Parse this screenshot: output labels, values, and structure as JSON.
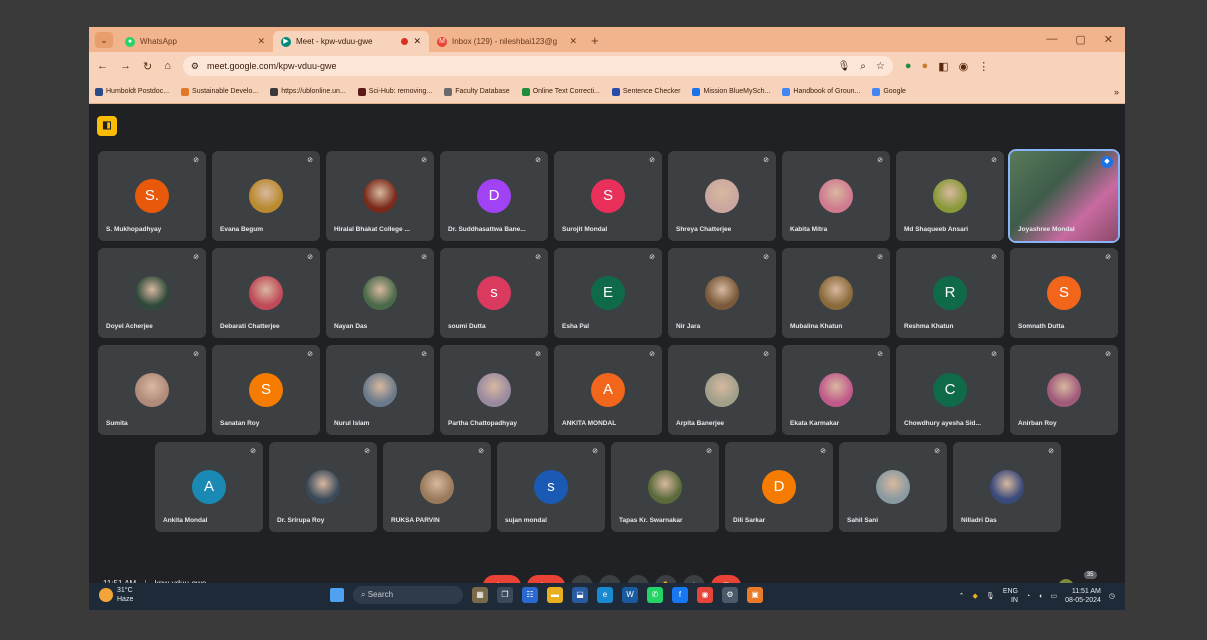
{
  "browser": {
    "tabs": [
      {
        "label": "WhatsApp",
        "active": false
      },
      {
        "label": "Meet - kpw-vduu-gwe",
        "active": true
      },
      {
        "label": "Inbox (129) - nileshbai123@g",
        "active": false
      }
    ],
    "url": "meet.google.com/kpw-vduu-gwe",
    "bookmarks": [
      "Humboldt Postdoc...",
      "Sustainable Develo...",
      "https://ublonline.un...",
      "Sci-Hub: removing...",
      "Faculty Database",
      "Online Text Correcti...",
      "Sentence Checker",
      "Mission BlueMySch...",
      "Handbook of Groun...",
      "Google"
    ]
  },
  "meet": {
    "participants": [
      {
        "name": "S. Mukhopadhyay",
        "initial": "S.",
        "color": "#e8590c",
        "type": "initial"
      },
      {
        "name": "Evana Begum",
        "type": "photo",
        "color": "#b98a2e"
      },
      {
        "name": "Hiralal Bhakat College ...",
        "type": "photo",
        "color": "#7a2a1a"
      },
      {
        "name": "Dr. Suddhasattwa Bane...",
        "initial": "D",
        "color": "#a142f4",
        "type": "initial"
      },
      {
        "name": "Surojit Mondal",
        "initial": "S",
        "color": "#e8305a",
        "type": "initial"
      },
      {
        "name": "Shreya Chatterjee",
        "type": "photo",
        "color": "#c9a7a0"
      },
      {
        "name": "Kabita Mitra",
        "type": "photo",
        "color": "#d07a90"
      },
      {
        "name": "Md Shaqueeb Ansari",
        "type": "photo",
        "color": "#8a9a3a"
      },
      {
        "name": "Joyashree Mondal",
        "type": "video",
        "color": "#5a7a5a"
      },
      {
        "name": "Doyel Acherjee",
        "type": "photo",
        "color": "#2f4a3a"
      },
      {
        "name": "Debarati Chatterjee",
        "type": "photo",
        "color": "#c04a5a"
      },
      {
        "name": "Nayan Das",
        "type": "photo",
        "color": "#4a6a4a"
      },
      {
        "name": "soumi Dutta",
        "initial": "s",
        "color": "#d93a5e",
        "type": "initial"
      },
      {
        "name": "Esha Pal",
        "initial": "E",
        "color": "#0f6a4a",
        "type": "initial"
      },
      {
        "name": "Nir Jara",
        "type": "photo",
        "color": "#7a5a3a"
      },
      {
        "name": "Mubalina Khatun",
        "type": "photo",
        "color": "#8a6a3a"
      },
      {
        "name": "Reshma Khatun",
        "initial": "R",
        "color": "#0f6a4a",
        "type": "initial"
      },
      {
        "name": "Somnath Dutta",
        "initial": "S",
        "color": "#f2661c",
        "type": "initial"
      },
      {
        "name": "Sumita",
        "type": "photo",
        "color": "#b08a7a"
      },
      {
        "name": "Sanatan Roy",
        "initial": "S",
        "color": "#f57c00",
        "type": "initial"
      },
      {
        "name": "Nurul Islam",
        "type": "photo",
        "color": "#6a7a8a"
      },
      {
        "name": "Partha Chattopadhyay",
        "type": "photo",
        "color": "#9a8aa0"
      },
      {
        "name": "ANKITA MONDAL",
        "initial": "A",
        "color": "#f2661c",
        "type": "initial"
      },
      {
        "name": "Arpita Banerjee",
        "type": "photo",
        "color": "#a0a08a"
      },
      {
        "name": "Ekata Karmakar",
        "type": "photo",
        "color": "#c05a8a"
      },
      {
        "name": "Chowdhury ayesha Sid...",
        "initial": "C",
        "color": "#0f6a4a",
        "type": "initial"
      },
      {
        "name": "Anirban Roy",
        "type": "photo",
        "color": "#a05a7a"
      },
      {
        "name": "Ankita Mondal",
        "initial": "A",
        "color": "#1a8ab4",
        "type": "initial"
      },
      {
        "name": "Dr. Srirupa Roy",
        "type": "photo",
        "color": "#3a4a5a"
      },
      {
        "name": "RUKSA PARVIN",
        "type": "photo",
        "color": "#9a7a5a"
      },
      {
        "name": "sujan mondal",
        "initial": "s",
        "color": "#1a5ab4",
        "type": "initial"
      },
      {
        "name": "Tapas Kr. Swarnakar",
        "type": "photo",
        "color": "#5a6a3a"
      },
      {
        "name": "Dili Sarkar",
        "initial": "D",
        "color": "#f57c00",
        "type": "initial"
      },
      {
        "name": "Sahil Sani",
        "type": "photo",
        "color": "#8a9aa0"
      },
      {
        "name": "Nilladri Das",
        "type": "photo",
        "color": "#3a4a7a"
      }
    ],
    "time": "11:51 AM",
    "meeting_code": "kpw-vduu-gwe",
    "participant_count": "35"
  },
  "taskbar": {
    "weather_temp": "31°C",
    "weather_desc": "Haze",
    "search_placeholder": "Search",
    "lang": "ENG",
    "lang_region": "IN",
    "clock_time": "11:51 AM",
    "clock_date": "08-05-2024"
  }
}
